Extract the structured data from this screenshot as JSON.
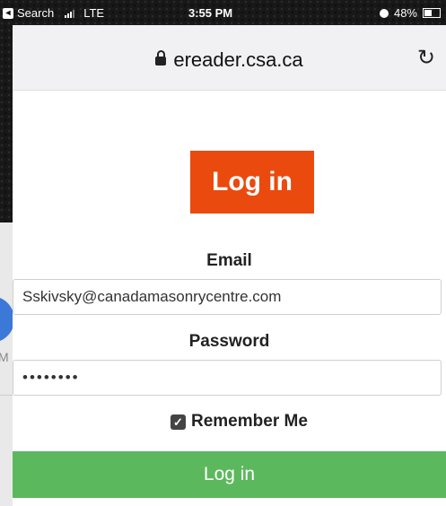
{
  "status_bar": {
    "back_app": "Search",
    "network": "LTE",
    "time": "3:55 PM",
    "battery": "48%"
  },
  "browser": {
    "url": "ereader.csa.ca"
  },
  "form": {
    "title": "Log in",
    "email_label": "Email",
    "email_value": "Sskivsky@canadamasonrycentre.com",
    "password_label": "Password",
    "password_value": "••••••••",
    "remember_label": "Remember Me",
    "remember_checked": true,
    "submit_label": "Log in"
  },
  "background_peek": {
    "letter": "M"
  },
  "colors": {
    "banner": "#ea4a0e",
    "submit": "#5cb85c"
  }
}
